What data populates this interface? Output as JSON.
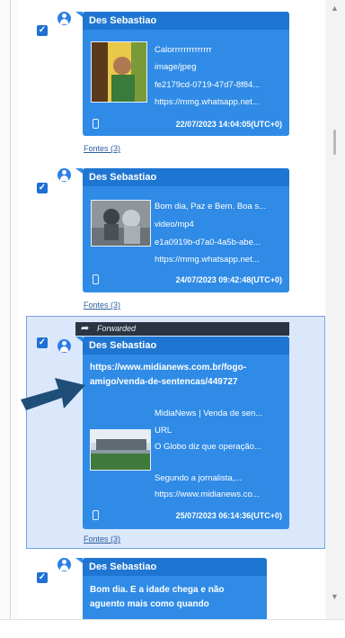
{
  "messages": [
    {
      "sender": "Des Sebastiao",
      "lines": [
        "Calorrrrrrrrrrrrrr",
        "image/jpeg",
        "fe2179cd-0719-47d7-8f84...",
        "https://mmg.whatsapp.net..."
      ],
      "timestamp": "22/07/2023 14:04:05(UTC+0)",
      "sources": "Fontes (3)"
    },
    {
      "sender": "Des Sebastiao",
      "lines": [
        "Bom dia, Paz e Bem. Boa s...",
        "video/mp4",
        "e1a0919b-d7a0-4a5b-abe...",
        "https://mmg.whatsapp.net..."
      ],
      "timestamp": "24/07/2023 09:42:48(UTC+0)",
      "sources": "Fontes (3)"
    },
    {
      "forwarded_label": "Forwarded",
      "sender": "Des Sebastiao",
      "link_lines": [
        "https://www.midianews.com.br/fogo-",
        "amigo/venda-de-sentencas/449727"
      ],
      "lines": [
        "MidiaNews | Venda de sen...",
        "URL",
        "O Globo diz que operação...",
        "",
        "Segundo a jornalista,...",
        "https://www.midianews.co..."
      ],
      "timestamp": "25/07/2023 06:14:36(UTC+0)",
      "sources": "Fontes (3)"
    },
    {
      "sender": "Des Sebastiao",
      "body_lines": [
        "Bom dia. E a idade chega e não",
        "aguento mais como quando"
      ]
    }
  ],
  "colors": {
    "bubble": "#2f8be6",
    "sender_bar": "#1f76d2",
    "selection": "#dbe7fb",
    "checkbox": "#1e6fd6",
    "arrow": "#1f4e79"
  },
  "icons": {
    "checkbox": "check-icon",
    "avatar": "user-icon",
    "device": "phone-icon",
    "forward": "forward-arrow-icon"
  }
}
